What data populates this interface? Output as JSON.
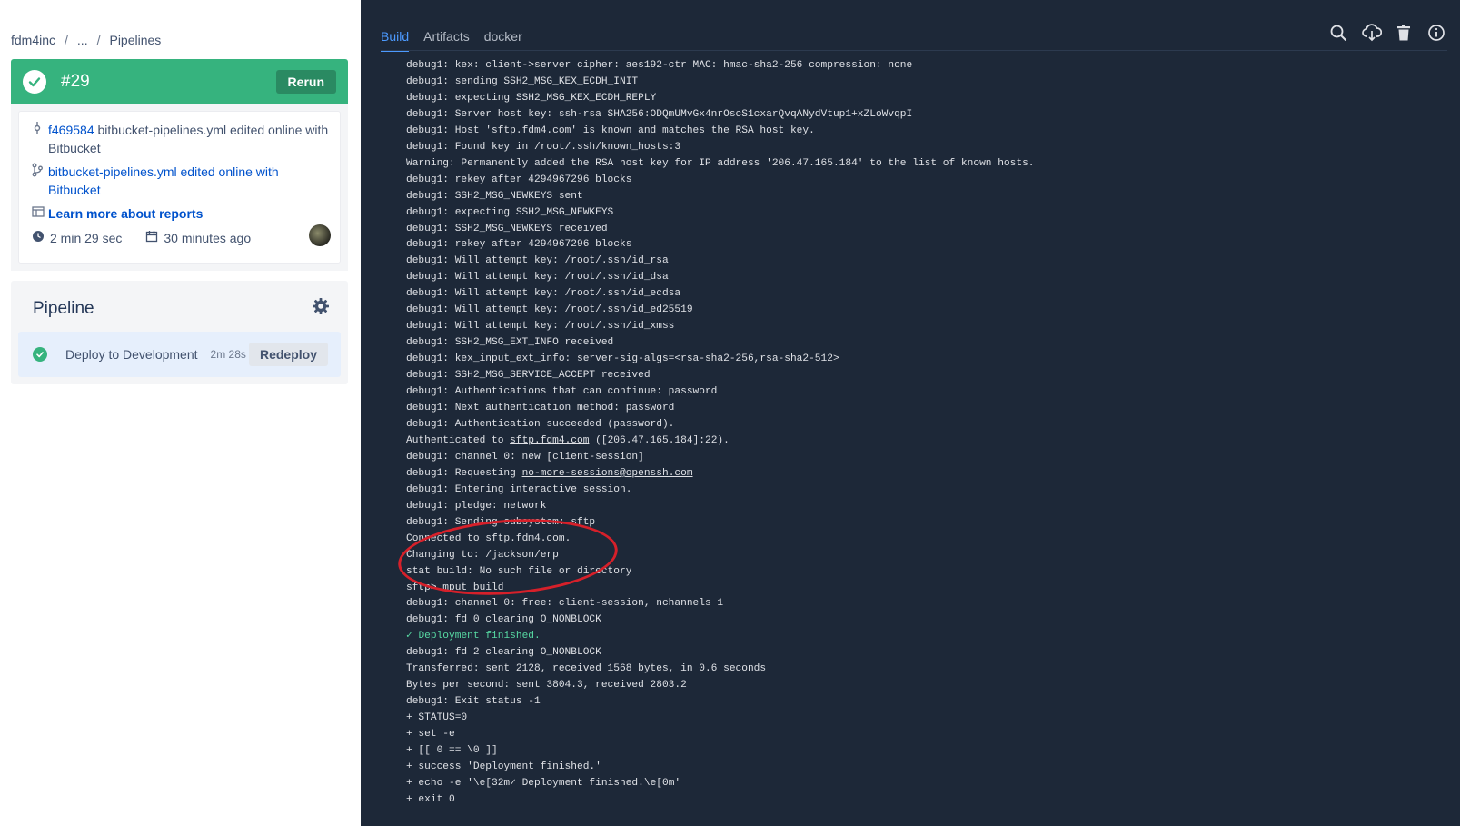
{
  "breadcrumb": {
    "org": "fdm4inc",
    "ellipsis": "...",
    "current": "Pipelines"
  },
  "build": {
    "number": "#29",
    "rerun_label": "Rerun",
    "status_color": "#36b37e",
    "commit_hash": "f469584",
    "commit_message": " bitbucket-pipelines.yml edited online with Bitbucket",
    "branch_link": "bitbucket-pipelines.yml edited online with Bitbucket",
    "reports_link": "Learn more about reports",
    "duration": "2 min 29 sec",
    "started": "30 minutes ago"
  },
  "pipeline": {
    "title": "Pipeline",
    "step_name": "Deploy to Development",
    "step_duration": "2m 28s",
    "redeploy_label": "Redeploy"
  },
  "tabs": [
    {
      "label": "Build"
    },
    {
      "label": "Artifacts"
    },
    {
      "label": "docker"
    }
  ],
  "icons": {
    "tools": [
      "search-icon",
      "download-cloud-icon",
      "trash-icon",
      "info-icon"
    ],
    "commit": "commit-icon",
    "branch": "branch-icon",
    "reports": "reports-icon",
    "clock": "clock-icon",
    "calendar": "calendar-icon",
    "settings": "gear-icon"
  },
  "log_lines": [
    [
      {
        "t": "debug1: kex: client->server cipher: aes192-ctr MAC: hmac-sha2-256 compression: none"
      }
    ],
    [
      {
        "t": "debug1: sending SSH2_MSG_KEX_ECDH_INIT"
      }
    ],
    [
      {
        "t": "debug1: expecting SSH2_MSG_KEX_ECDH_REPLY"
      }
    ],
    [
      {
        "t": "debug1: Server host key: ssh-rsa SHA256:ODQmUMvGx4nrOscS1cxarQvqANydVtup1+xZLoWvqpI"
      }
    ],
    [
      {
        "t": "debug1: Host '"
      },
      {
        "t": "sftp.fdm4.com",
        "u": true
      },
      {
        "t": "' is known and matches the RSA host key."
      }
    ],
    [
      {
        "t": "debug1: Found key in /root/.ssh/known_hosts:3"
      }
    ],
    [
      {
        "t": "Warning: Permanently added the RSA host key for IP address '206.47.165.184' to the list of known hosts."
      }
    ],
    [
      {
        "t": "debug1: rekey after 4294967296 blocks"
      }
    ],
    [
      {
        "t": "debug1: SSH2_MSG_NEWKEYS sent"
      }
    ],
    [
      {
        "t": "debug1: expecting SSH2_MSG_NEWKEYS"
      }
    ],
    [
      {
        "t": "debug1: SSH2_MSG_NEWKEYS received"
      }
    ],
    [
      {
        "t": "debug1: rekey after 4294967296 blocks"
      }
    ],
    [
      {
        "t": "debug1: Will attempt key: /root/.ssh/id_rsa"
      }
    ],
    [
      {
        "t": "debug1: Will attempt key: /root/.ssh/id_dsa"
      }
    ],
    [
      {
        "t": "debug1: Will attempt key: /root/.ssh/id_ecdsa"
      }
    ],
    [
      {
        "t": "debug1: Will attempt key: /root/.ssh/id_ed25519"
      }
    ],
    [
      {
        "t": "debug1: Will attempt key: /root/.ssh/id_xmss"
      }
    ],
    [
      {
        "t": "debug1: SSH2_MSG_EXT_INFO received"
      }
    ],
    [
      {
        "t": "debug1: kex_input_ext_info: server-sig-algs=<rsa-sha2-256,rsa-sha2-512>"
      }
    ],
    [
      {
        "t": "debug1: SSH2_MSG_SERVICE_ACCEPT received"
      }
    ],
    [
      {
        "t": "debug1: Authentications that can continue: password"
      }
    ],
    [
      {
        "t": "debug1: Next authentication method: password"
      }
    ],
    [
      {
        "t": "debug1: Authentication succeeded (password)."
      }
    ],
    [
      {
        "t": "Authenticated to "
      },
      {
        "t": "sftp.fdm4.com",
        "u": true
      },
      {
        "t": " ([206.47.165.184]:22)."
      }
    ],
    [
      {
        "t": "debug1: channel 0: new [client-session]"
      }
    ],
    [
      {
        "t": "debug1: Requesting "
      },
      {
        "t": "no-more-sessions@openssh.com",
        "u": true
      }
    ],
    [
      {
        "t": "debug1: Entering interactive session."
      }
    ],
    [
      {
        "t": "debug1: pledge: network"
      }
    ],
    [
      {
        "t": "debug1: Sending subsystem: sftp"
      }
    ],
    [
      {
        "t": "Connected to "
      },
      {
        "t": "sftp.fdm4.com",
        "u": true
      },
      {
        "t": "."
      }
    ],
    [
      {
        "t": "Changing to: /jackson/erp"
      }
    ],
    [
      {
        "t": "stat build: No such file or directory"
      }
    ],
    [
      {
        "t": "sftp> mput build"
      }
    ],
    [
      {
        "t": "debug1: channel 0: free: client-session, nchannels 1"
      }
    ],
    [
      {
        "t": "debug1: fd 0 clearing O_NONBLOCK"
      }
    ],
    [
      {
        "t": "✓ Deployment finished.",
        "ok": true
      }
    ],
    [
      {
        "t": "debug1: fd 2 clearing O_NONBLOCK"
      }
    ],
    [
      {
        "t": "Transferred: sent 2128, received 1568 bytes, in 0.6 seconds"
      }
    ],
    [
      {
        "t": "Bytes per second: sent 3804.3, received 2803.2"
      }
    ],
    [
      {
        "t": "debug1: Exit status -1"
      }
    ],
    [
      {
        "t": "+ STATUS=0"
      }
    ],
    [
      {
        "t": "+ set -e"
      }
    ],
    [
      {
        "t": "+ [[ 0 == \\0 ]]"
      }
    ],
    [
      {
        "t": "+ success 'Deployment finished.'"
      }
    ],
    [
      {
        "t": "+ echo -e '\\e[32m✓ Deployment finished.\\e[0m'"
      }
    ],
    [
      {
        "t": "+ exit 0"
      }
    ]
  ]
}
